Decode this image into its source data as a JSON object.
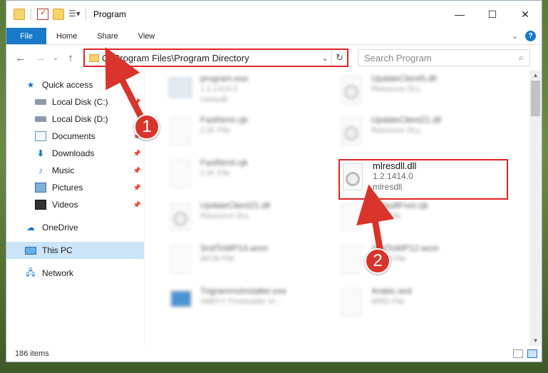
{
  "window": {
    "title": "Program",
    "controls": {
      "minimize": "—",
      "maximize": "☐",
      "close": "✕"
    }
  },
  "ribbon": {
    "tabs": [
      {
        "label": "File"
      },
      {
        "label": "Home"
      },
      {
        "label": "Share"
      },
      {
        "label": "View"
      }
    ],
    "help": "?"
  },
  "address": {
    "path": "C:\\Program Files\\Program Directory",
    "search_placeholder": "Search Program"
  },
  "nav_pane": {
    "quick_access": "Quick access",
    "local_c": "Local Disk (C:)",
    "local_d": "Local Disk (D:)",
    "documents": "Documents",
    "downloads": "Downloads",
    "music": "Music",
    "pictures": "Pictures",
    "videos": "Videos",
    "onedrive": "OneDrive",
    "this_pc": "This PC",
    "network": "Network"
  },
  "files": [
    {
      "name": "program.exe",
      "line2": "1.2.1414.0",
      "line3": "mlresdll"
    },
    {
      "name": "UpdateClient5.dll",
      "line2": "Resource DLL"
    },
    {
      "name": "FastNrml.cjk",
      "line2": "CJK File"
    },
    {
      "name": "UpdateClient21.dll",
      "line2": "Resource DLL"
    },
    {
      "name": "FastNrml.cjk",
      "line2": "CJK File"
    },
    {
      "name": "mlresdll.dll",
      "line2": "1.2.1414.0",
      "line3": "mlresdll"
    },
    {
      "name": "UpdateClient21.dll",
      "line2": "Resource DLL"
    },
    {
      "name": "DefaultFont.cjk",
      "line2": "CJK File"
    },
    {
      "name": "SndToWP14.wcm",
      "line2": "WCM File"
    },
    {
      "name": "SndToWP12.wcm",
      "line2": "WCM File"
    },
    {
      "name": "TrigrammsInstaller.exe",
      "line2": "ABBYY Finereader tri..."
    },
    {
      "name": "Arabic.wrd",
      "line2": "WRD File"
    }
  ],
  "status": {
    "items": "186 items"
  },
  "annotations": {
    "step1": "1",
    "step2": "2"
  },
  "colors": {
    "accent": "#1979ca",
    "highlight": "#e02424",
    "badge": "#d9342b"
  }
}
